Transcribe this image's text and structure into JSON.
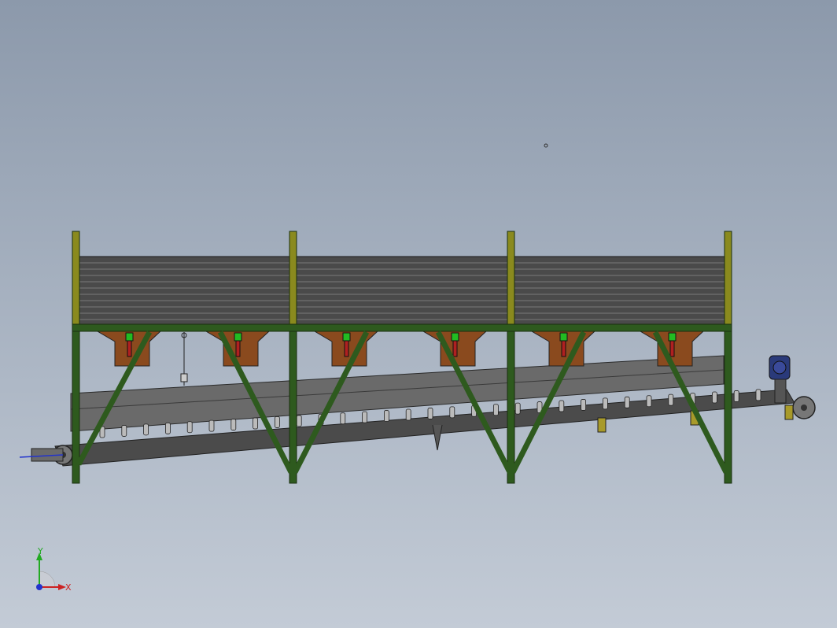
{
  "viewport": {
    "background_top": "#8c99ab",
    "background_bottom": "#c3cbd6"
  },
  "model": {
    "frame_color": "#2e5a1e",
    "post_cap_color": "#8a8a1e",
    "bin_color": "#4a4a4a",
    "hopper_color": "#8a4a1e",
    "gate_color": "#22bb22",
    "conveyor_color": "#555555",
    "motor_color": "#2a3a7a"
  },
  "triad": {
    "x_label": "X",
    "y_label": "Y",
    "x_color": "#cc2222",
    "y_color": "#22aa22",
    "z_color": "#2233cc"
  }
}
